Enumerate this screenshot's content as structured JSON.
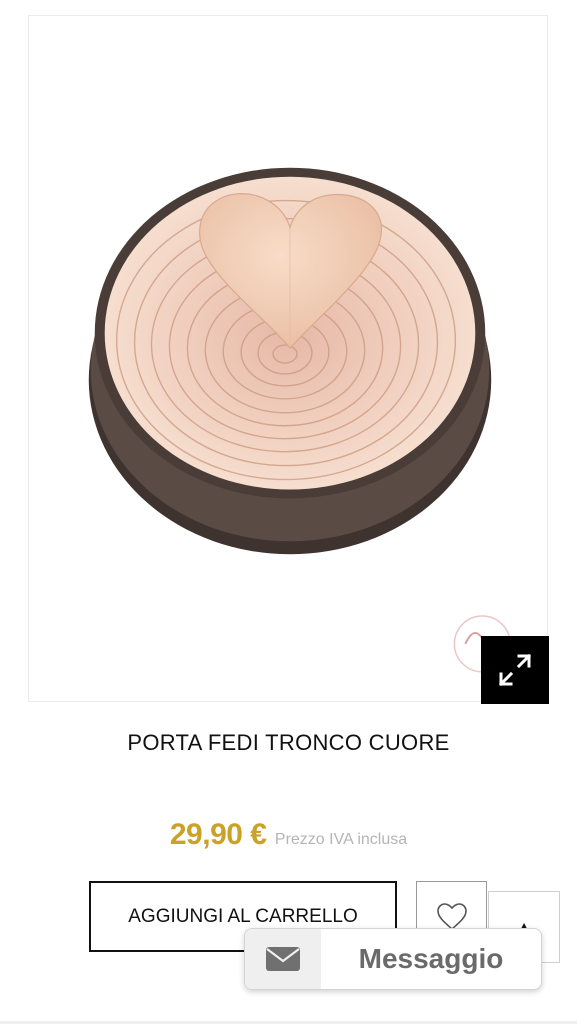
{
  "product": {
    "title": "PORTA FEDI TRONCO CUORE",
    "image_alt": "Porta fedi tronco cuore",
    "watermark_icon": "logo-watermark-icon"
  },
  "gallery": {
    "zoom_icon": "expand-icon"
  },
  "pricing": {
    "price": "29,90 €",
    "vat_note": "Prezzo IVA inclusa",
    "price_color": "#c9a227"
  },
  "actions": {
    "add_to_cart_label": "AGGIUNGI AL CARRELLO",
    "wishlist_icon": "heart-outline-icon",
    "scroll_top_icon": "arrow-up-icon"
  },
  "chat_widget": {
    "label": "Messaggio",
    "icon": "envelope-icon"
  }
}
